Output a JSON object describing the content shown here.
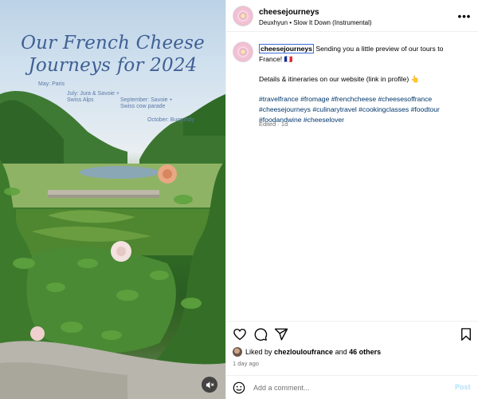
{
  "media": {
    "title_line1": "Our French Cheese",
    "title_line2": "Journeys for 2024",
    "tags": {
      "may": "May: Paris",
      "july_1": "July: Jura & Savoie +",
      "july_2": "Swiss Alps",
      "sept_1": "September: Savoie +",
      "sept_2": "Swiss cow parade",
      "oct": "October: Burgundy"
    },
    "mute_icon": "speaker-muted-icon"
  },
  "header": {
    "username": "cheesejourneys",
    "audio": "Deuxhyun • Slow It Down (Instrumental)",
    "more_icon": "more-horizontal-icon",
    "more_label": "•••"
  },
  "caption": {
    "username": "cheesejourneys",
    "line1": " Sending you a little preview of our tours to",
    "line2": "France! 🇫🇷",
    "details": "Details & itineraries on our website (link in profile) 👆",
    "hashtags_line1": "#travelfrance #fromage #frenchcheese #cheesesoffrance",
    "hashtags_line2": "#cheesejourneys #culinarytravel #cookingclasses #foodtour",
    "hashtags_line3": "#foodandwine #cheeselover",
    "edited": "Edited · 1d"
  },
  "actions": {
    "like_icon": "heart-icon",
    "comment_icon": "comment-bubble-icon",
    "share_icon": "paper-plane-icon",
    "save_icon": "bookmark-icon"
  },
  "likes": {
    "prefix": "Liked by ",
    "user": "chezlouloufrance",
    "middle": " and ",
    "others": "46 others"
  },
  "timestamp": "1 day ago",
  "comment": {
    "emoji_icon": "smiley-icon",
    "placeholder": "Add a comment...",
    "post_label": "Post"
  },
  "colors": {
    "hashtag": "#00376b",
    "title_blue": "#3f5f94",
    "post_disabled": "#b2dffc"
  }
}
